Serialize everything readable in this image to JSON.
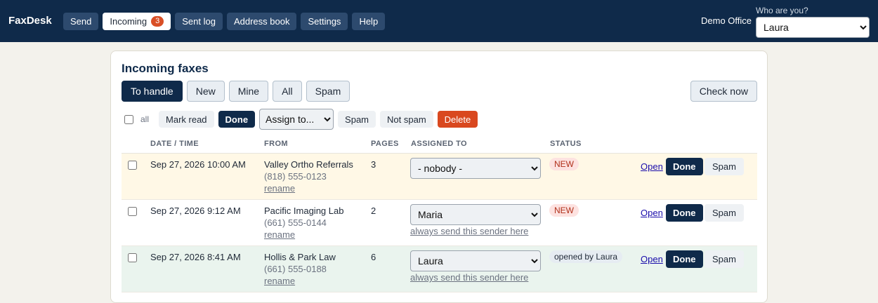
{
  "app": {
    "brand": "FaxDesk",
    "nav": [
      {
        "label": "Send"
      },
      {
        "label": "Incoming",
        "badge": "3"
      },
      {
        "label": "Sent log"
      },
      {
        "label": "Address book"
      },
      {
        "label": "Settings"
      },
      {
        "label": "Help"
      }
    ],
    "office": "Demo Office",
    "who_label": "Who are you?",
    "who_value": "Laura"
  },
  "page": {
    "title": "Incoming faxes",
    "filters": [
      "To handle",
      "New",
      "Mine",
      "All",
      "Spam"
    ],
    "check_now": "Check now"
  },
  "bulk": {
    "all_label": "all",
    "mark_read": "Mark read",
    "done": "Done",
    "assign_value": "Assign to...",
    "spam": "Spam",
    "not_spam": "Not spam",
    "delete": "Delete"
  },
  "table": {
    "headers": [
      "DATE / TIME",
      "FROM",
      "PAGES",
      "ASSIGNED TO",
      "STATUS"
    ],
    "rename_label": "rename",
    "always_label": "always send this sender here",
    "open_label": "Open",
    "done_label": "Done",
    "spam_label": "Spam",
    "rows": [
      {
        "datetime": "Sep 27, 2026 10:00 AM",
        "from_name": "Valley Ortho Referrals",
        "from_phone": "(818) 555-0123",
        "pages": "3",
        "assigned": "- nobody -",
        "always": "",
        "status": "NEW"
      },
      {
        "datetime": "Sep 27, 2026 9:12 AM",
        "from_name": "Pacific Imaging Lab",
        "from_phone": "(661) 555-0144",
        "pages": "2",
        "assigned": "Maria",
        "always": "always send this sender here",
        "status": "NEW"
      },
      {
        "datetime": "Sep 27, 2026 8:41 AM",
        "from_name": "Hollis & Park Law",
        "from_phone": "(661) 555-0188",
        "pages": "6",
        "assigned": "Laura",
        "always": "always send this sender here",
        "status": "opened by Laura"
      }
    ]
  }
}
